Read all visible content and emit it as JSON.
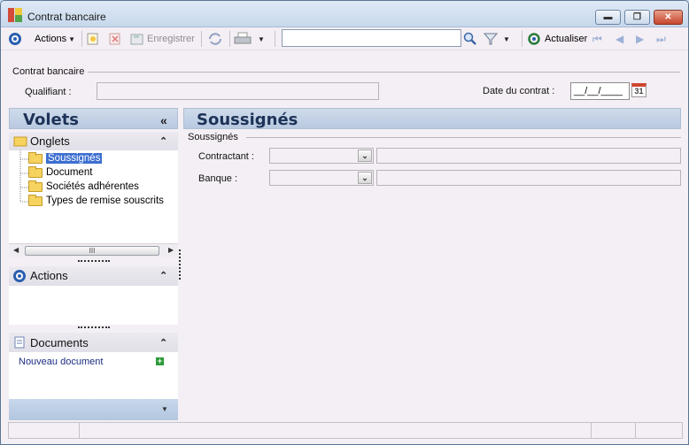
{
  "window": {
    "title": "Contrat bancaire",
    "min_glyph": "▬",
    "max_glyph": "❐",
    "close_glyph": "✕"
  },
  "toolbar": {
    "actions_label": "Actions",
    "save_label": "Enregistrer",
    "search_value": "",
    "refresh_label": "Actualiser",
    "icons": [
      "target-icon",
      "new-doc-icon",
      "delete-icon",
      "save-icon",
      "sync-icon",
      "print-icon",
      "search-icon",
      "filter-icon",
      "refresh-icon",
      "first-icon",
      "prev-icon",
      "next-icon",
      "last-icon"
    ]
  },
  "header": {
    "section_label": "Contrat bancaire",
    "qualifiant_label": "Qualifiant :",
    "qualifiant_value": "",
    "date_label": "Date du contrat :",
    "date_value": "__/__/____",
    "calendar_day": "31"
  },
  "sidebar": {
    "title": "Volets",
    "collapse_glyph": "«",
    "onglets_title": "Onglets",
    "tree": [
      {
        "label": "Soussignés",
        "selected": true
      },
      {
        "label": "Document",
        "selected": false
      },
      {
        "label": "Sociétés adhérentes",
        "selected": false
      },
      {
        "label": "Types de remise souscrits",
        "selected": false
      }
    ],
    "actions_title": "Actions",
    "documents_title": "Documents",
    "new_document_label": "Nouveau document",
    "scroll_thumb": "III"
  },
  "main": {
    "title": "Soussignés",
    "section_label": "Soussignés",
    "contractant_label": "Contractant :",
    "banque_label": "Banque :"
  },
  "colors": {
    "accent": "#2a5fb0",
    "selection": "#3d6fd1",
    "panel_header": "#b8c9e0"
  }
}
